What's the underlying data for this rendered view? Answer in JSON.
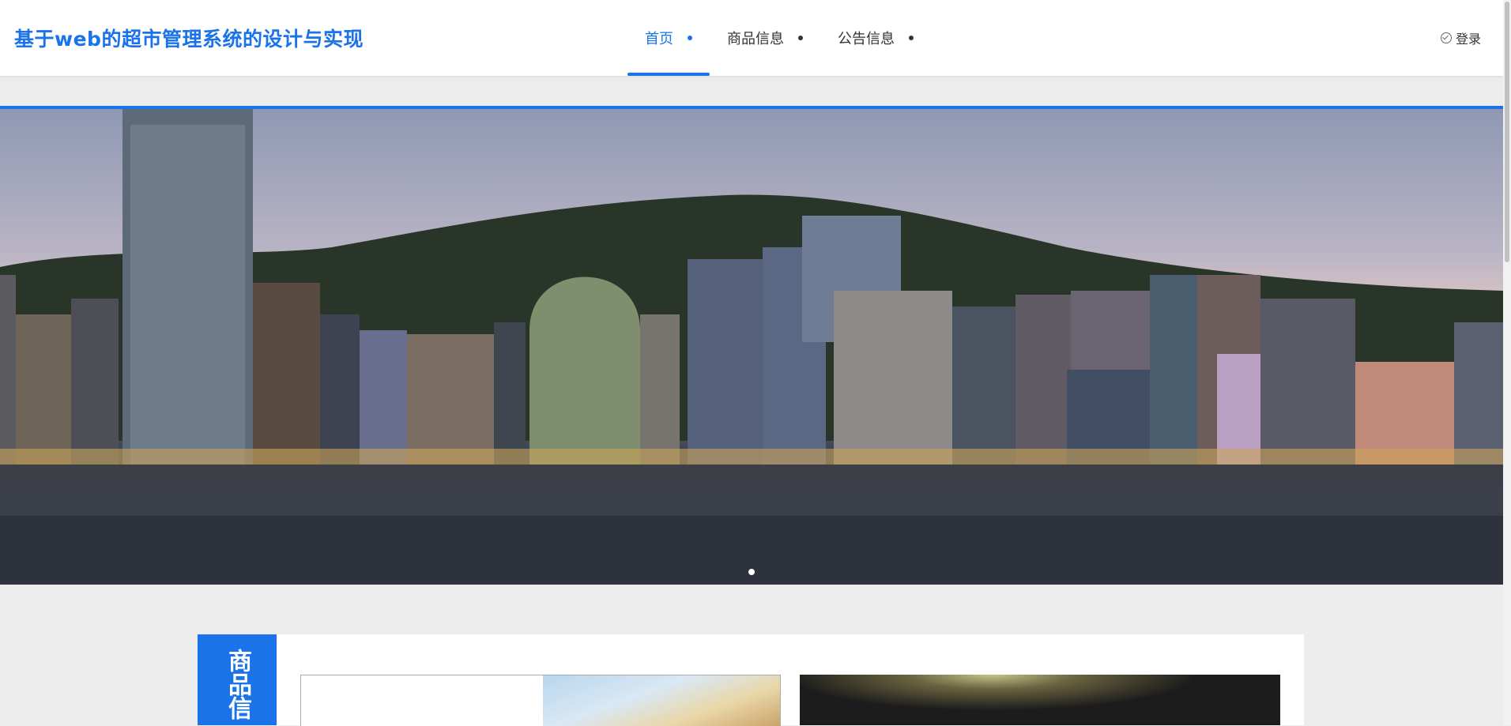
{
  "header": {
    "title": "基于web的超市管理系统的设计与实现",
    "nav": [
      {
        "label": "首页",
        "active": true
      },
      {
        "label": "商品信息",
        "active": false
      },
      {
        "label": "公告信息",
        "active": false
      }
    ],
    "login_label": "登录"
  },
  "banner": {
    "image": "city-skyline-harbor-photo",
    "slides_total": 1,
    "active_slide": 1
  },
  "section": {
    "tag_label": "商品信"
  },
  "colors": {
    "accent": "#1a73e8",
    "text": "#333333",
    "page_bg": "#ececec"
  }
}
